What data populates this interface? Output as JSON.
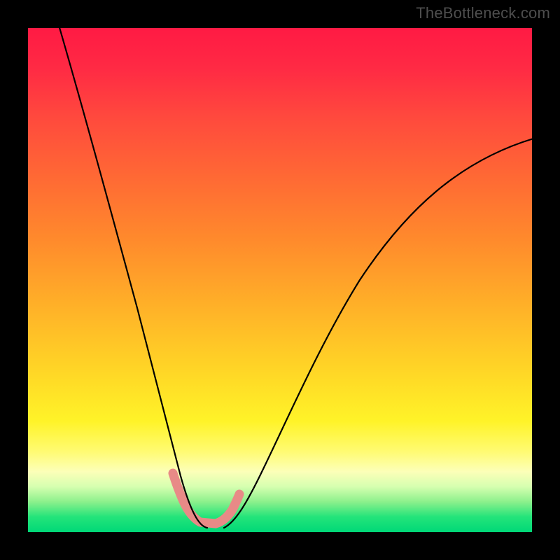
{
  "watermark": "TheBottleneck.com",
  "colors": {
    "frame": "#000000",
    "gradient_top": "#ff1a44",
    "gradient_mid": "#ffd626",
    "gradient_bottom": "#00d877",
    "curve": "#000000",
    "accent_band": "#e88a87"
  },
  "chart_data": {
    "type": "line",
    "title": "",
    "xlabel": "",
    "ylabel": "",
    "xlim": [
      0,
      100
    ],
    "ylim": [
      0,
      100
    ],
    "series": [
      {
        "name": "left-curve",
        "x": [
          6,
          10,
          14,
          18,
          22,
          25,
          27,
          29,
          30.5,
          32,
          33.5,
          35
        ],
        "y": [
          100,
          84,
          68,
          52,
          37,
          25,
          17,
          10,
          6,
          3.5,
          1.5,
          0.5
        ]
      },
      {
        "name": "right-curve",
        "x": [
          40,
          42,
          45,
          50,
          56,
          63,
          71,
          80,
          90,
          100
        ],
        "y": [
          0.5,
          2.5,
          7,
          17,
          30,
          43,
          54,
          63,
          71,
          78
        ]
      },
      {
        "name": "accent-band",
        "x": [
          29,
          31,
          33,
          35,
          37.5,
          40,
          42
        ],
        "y": [
          11,
          5,
          1.5,
          0.8,
          0.8,
          2,
          6
        ]
      }
    ],
    "notes": "No axis ticks or numeric labels visible; values are normalized 0-100 estimates from pixel positions. y=100 is top of plot, y=0 is bottom."
  }
}
